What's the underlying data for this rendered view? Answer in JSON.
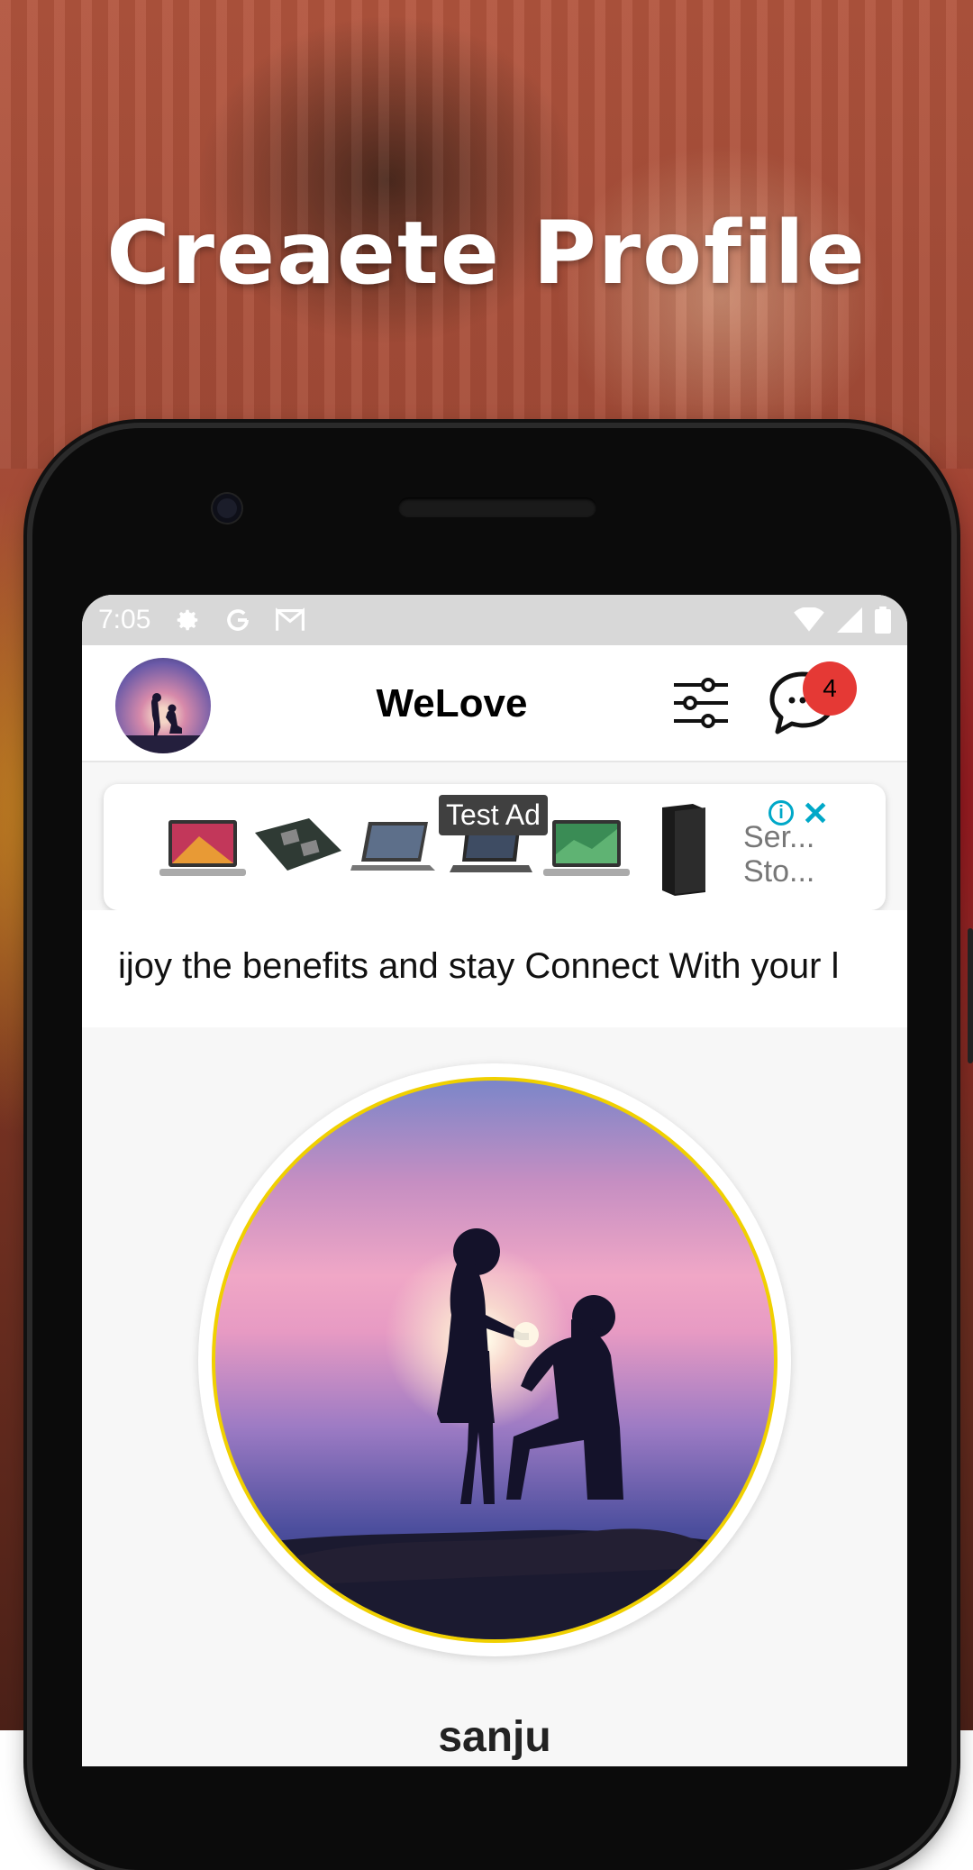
{
  "promo": {
    "headline": "Creaete Profile"
  },
  "status_bar": {
    "time": "7:05",
    "icons": [
      "settings-icon",
      "google-icon",
      "gmail-icon",
      "wifi-icon",
      "signal-icon",
      "battery-icon"
    ]
  },
  "app_bar": {
    "title": "WeLove",
    "chat_badge_count": "4"
  },
  "ad": {
    "tag": "Test Ad",
    "info_symbol": "i",
    "close_symbol": "✕",
    "text_line1": "Ser...",
    "text_line2": "Sto..."
  },
  "marquee": {
    "text": "ijoy the benefits and stay Connect With your l"
  },
  "profile": {
    "name": "sanju"
  },
  "colors": {
    "badge": "#e53935",
    "ring": "#f0d000",
    "ad_accent": "#00a8c8"
  }
}
